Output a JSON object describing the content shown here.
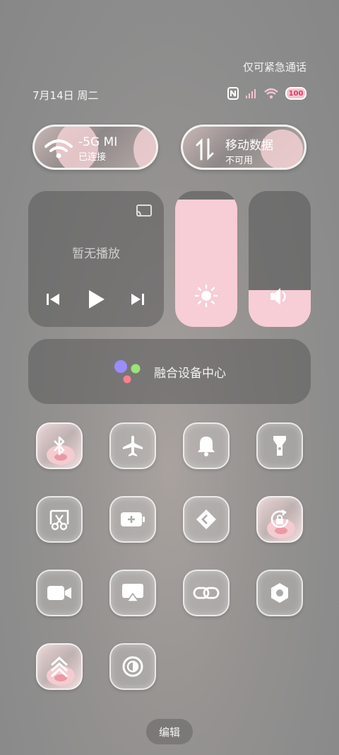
{
  "status": {
    "emergency_text": "仅可紧急通话",
    "date_text": "7月14日 周二",
    "battery_level": "100",
    "icons": [
      "nfc-icon",
      "signal-icon",
      "wifi-icon",
      "battery-icon"
    ]
  },
  "wifi_tile": {
    "ssid": "-5G  MI",
    "status": "已连接",
    "icon": "wifi-icon"
  },
  "mobile_data_tile": {
    "label": "移动数据",
    "status": "不可用",
    "icon": "data-arrows-icon"
  },
  "media": {
    "title": "暂无播放",
    "icons": [
      "cast-icon",
      "previous-icon",
      "play-icon",
      "next-icon"
    ]
  },
  "brightness": {
    "level": 0.94,
    "icon": "sun-icon"
  },
  "volume": {
    "level": 0.27,
    "icon": "speaker-icon"
  },
  "device_hub": {
    "label": "融合设备中心",
    "dot_colors": [
      "#9b8cff",
      "#9be37a",
      "#ff7f8a"
    ]
  },
  "toggles": [
    "bluetooth-icon",
    "airplane-icon",
    "bell-icon",
    "flashlight-icon",
    "screenshot-icon",
    "battery-saver-icon",
    "nearby-share-icon",
    "rotation-lock-icon",
    "screen-record-icon",
    "screen-cast-icon",
    "link-icon",
    "settings-icon",
    "performance-icon",
    "dark-mode-icon"
  ],
  "colors": {
    "accent_pink": "#f7cdd6",
    "battery_text": "#d23f67"
  },
  "edit_label": "编辑"
}
